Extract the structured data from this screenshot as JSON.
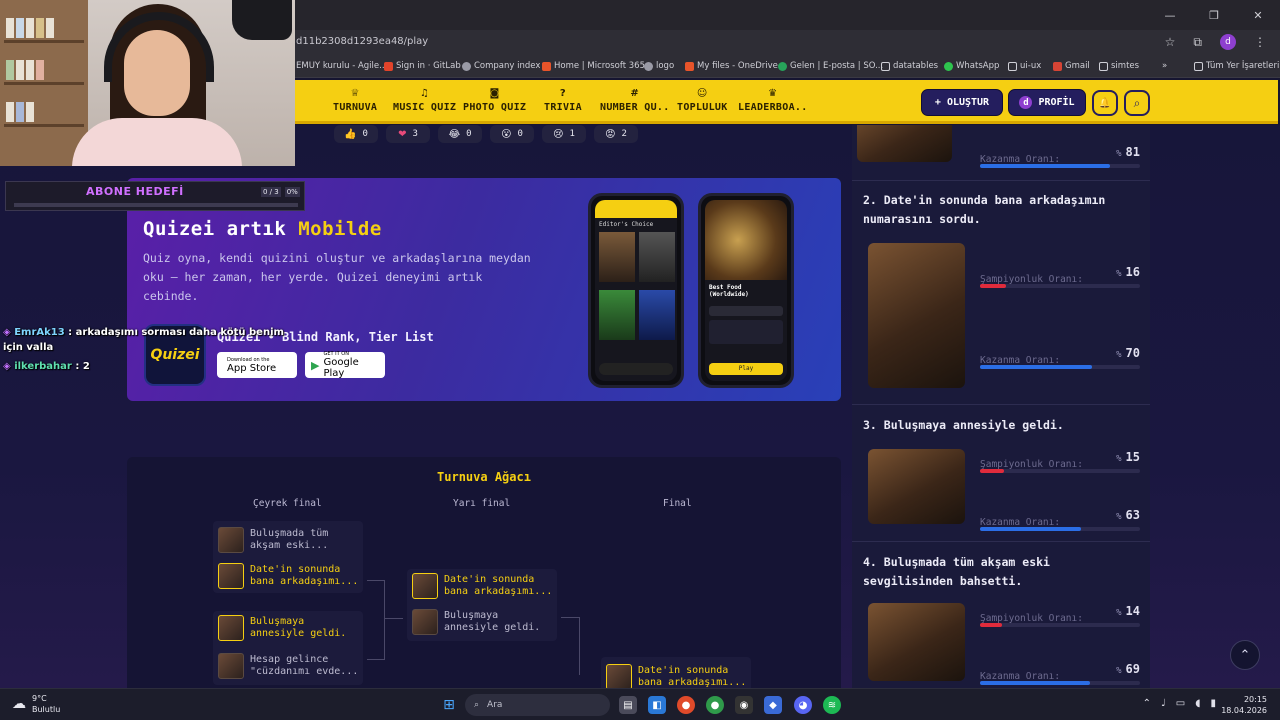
{
  "browser": {
    "url": "d11b2308d1293ea48/play",
    "window_controls": {
      "minimize": "—",
      "maximize": "❐",
      "close": "✕"
    },
    "bookmarks": [
      "EMUY kurulu - Agile...",
      "Sign in · GitLab",
      "Company index",
      "Home | Microsoft 365",
      "logo",
      "My files - OneDrive",
      "Gelen | E-posta | SO...",
      "datatables",
      "WhatsApp",
      "ui-ux",
      "Gmail",
      "simtes",
      "»",
      "Tüm Yer İşaretleri"
    ],
    "profile_letter": "d"
  },
  "nav": {
    "items": [
      {
        "label": "TURNUVA",
        "icon": "trophy-icon",
        "glyph": "♕"
      },
      {
        "label": "MUSIC QUIZ",
        "icon": "music-icon",
        "glyph": "♫"
      },
      {
        "label": "PHOTO QUIZ",
        "icon": "camera-icon",
        "glyph": "◙"
      },
      {
        "label": "TRIVIA",
        "icon": "question-icon",
        "glyph": "?"
      },
      {
        "label": "NUMBER QU..",
        "icon": "hash-icon",
        "glyph": "#"
      },
      {
        "label": "TOPLULUK",
        "icon": "users-icon",
        "glyph": "☺"
      },
      {
        "label": "LEADERBOA..",
        "icon": "medal-icon",
        "glyph": "♛"
      }
    ],
    "create_label": "OLUŞTUR",
    "create_icon": "+",
    "profile_label": "PROFİL",
    "profile_letter": "d",
    "bell_glyph": "🔔",
    "search_glyph": "⌕"
  },
  "reactions": [
    {
      "emoji": "👍",
      "count": "0"
    },
    {
      "emoji": "❤",
      "count": "3"
    },
    {
      "emoji": "😂",
      "count": "0"
    },
    {
      "emoji": "😮",
      "count": "0"
    },
    {
      "emoji": "😢",
      "count": "1"
    },
    {
      "emoji": "😡",
      "count": "2"
    }
  ],
  "promo": {
    "title_prefix": "Quizei artık ",
    "title_highlight": "Mobilde",
    "description": "Quiz oyna, kendi quizini oluştur ve arkadaşlarına meydan oku — her zaman, her yerde. Quizei deneyimi artık cebinde.",
    "tagline": "Quizei • Blind Rank, Tier List",
    "logo_text": "Quizei",
    "app_store_small": "Download on the",
    "app_store_big": "App Store",
    "google_small": "GET IT ON",
    "google_big": "Google Play",
    "phone1_header": "Editor's Choice",
    "phone2_header": "Best Food (Worldwide)",
    "phone2_button": "Play"
  },
  "tournament": {
    "title": "Turnuva Ağacı",
    "columns": [
      "Çeyrek final",
      "Yarı final",
      "Final"
    ],
    "quarter": [
      {
        "a": "Buluşmada tüm akşam eski...",
        "b": "Date'in sonunda bana arkadaşımı...",
        "winner": "b"
      },
      {
        "a": "Buluşmaya annesiyle geldi.",
        "b": "Hesap gelince \"cüzdanımı evde...",
        "winner": "a"
      }
    ],
    "semi": [
      {
        "a": "Date'in sonunda bana arkadaşımı...",
        "b": "Buluşmaya annesiyle geldi.",
        "winner": "a"
      }
    ],
    "final": [
      {
        "a": "Date'in sonunda bana arkadaşımı..."
      }
    ]
  },
  "ranking": {
    "first": {
      "win_label": "Kazanma Oranı:",
      "win_rate": "81",
      "win_value": 0.81
    },
    "items": [
      {
        "rank": "2.",
        "title": "Date'in sonunda bana arkadaşımın numarasını sordu.",
        "champ_label": "Şampiyonluk Oranı:",
        "champ_rate": "16",
        "champ_value": 0.16,
        "win_label": "Kazanma Oranı:",
        "win_rate": "70",
        "win_value": 0.7
      },
      {
        "rank": "3.",
        "title": "Buluşmaya annesiyle geldi.",
        "champ_label": "Şampiyonluk Oranı:",
        "champ_rate": "15",
        "champ_value": 0.15,
        "win_label": "Kazanma Oranı:",
        "win_rate": "63",
        "win_value": 0.63
      },
      {
        "rank": "4.",
        "title": "Buluşmada tüm akşam eski sevgilisinden bahsetti.",
        "champ_label": "Şampiyonluk Oranı:",
        "champ_rate": "14",
        "champ_value": 0.14,
        "win_label": "Kazanma Oranı:",
        "win_rate": "69",
        "win_value": 0.69
      }
    ],
    "percent_sign": "%"
  },
  "stream": {
    "goal_label": "ABONE HEDEFİ",
    "goal_count": "0 / 3",
    "goal_percent": "0%",
    "goal_progress": 0.0,
    "chat": [
      {
        "user": "EmrAk13",
        "message": "arkadaşımı sorması daha kötü benim için valla"
      },
      {
        "user": "ilkerbahar",
        "message": "2"
      }
    ]
  },
  "taskbar": {
    "temperature": "9°C",
    "condition": "Bulutlu",
    "search_placeholder": "Ara",
    "time": "20:15",
    "date": "18.04.2026"
  },
  "colors": {
    "accent_yellow": "#f5cf12",
    "nav_dark": "#241e5e",
    "bar_red": "#e02b3c",
    "bar_blue": "#2b6ee6",
    "promo_purple": "#5a1fa8"
  }
}
